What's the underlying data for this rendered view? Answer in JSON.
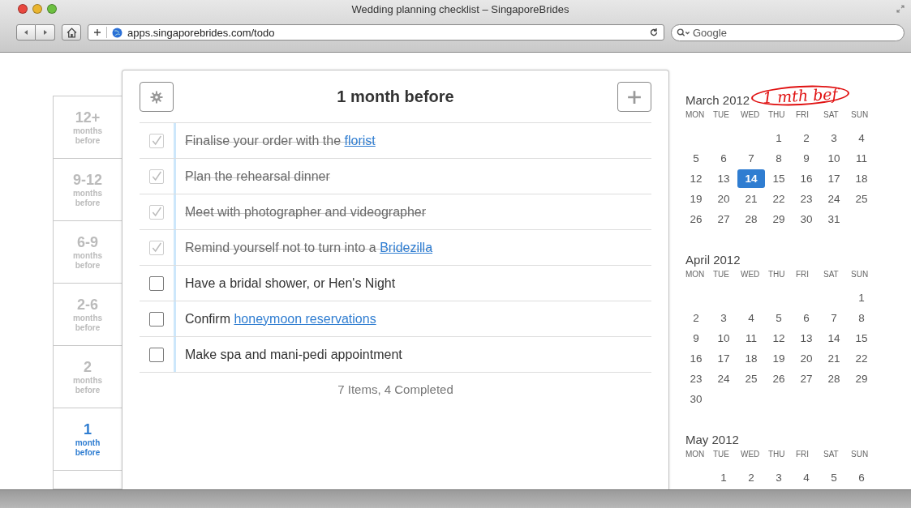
{
  "window": {
    "title": "Wedding planning checklist – SingaporeBrides"
  },
  "toolbar": {
    "url": "apps.singaporebrides.com/todo",
    "search": {
      "placeholder": "Google"
    }
  },
  "sidebar": {
    "items": [
      {
        "number": "12+",
        "lines": [
          "months",
          "before"
        ],
        "selected": false
      },
      {
        "number": "9-12",
        "lines": [
          "months",
          "before"
        ],
        "selected": false
      },
      {
        "number": "6-9",
        "lines": [
          "months",
          "before"
        ],
        "selected": false
      },
      {
        "number": "2-6",
        "lines": [
          "months",
          "before"
        ],
        "selected": false
      },
      {
        "number": "2",
        "lines": [
          "months",
          "before"
        ],
        "selected": false
      },
      {
        "number": "1",
        "lines": [
          "month",
          "before"
        ],
        "selected": true
      }
    ]
  },
  "checklist": {
    "title": "1 month before",
    "footer": "7 Items, 4 Completed",
    "items": [
      {
        "checked": true,
        "parts": [
          {
            "text": "Finalise your order with the "
          },
          {
            "text": "florist",
            "link": true
          }
        ]
      },
      {
        "checked": true,
        "parts": [
          {
            "text": "Plan the rehearsal dinner"
          }
        ]
      },
      {
        "checked": true,
        "parts": [
          {
            "text": "Meet with photographer and videographer"
          }
        ]
      },
      {
        "checked": true,
        "parts": [
          {
            "text": "Remind yourself not to turn into a "
          },
          {
            "text": "Bridezilla",
            "link": true
          }
        ]
      },
      {
        "checked": false,
        "parts": [
          {
            "text": "Have a bridal shower, or Hen's Night"
          }
        ]
      },
      {
        "checked": false,
        "parts": [
          {
            "text": "Confirm "
          },
          {
            "text": "honeymoon reservations",
            "link": true
          }
        ]
      },
      {
        "checked": false,
        "parts": [
          {
            "text": "Make spa and mani-pedi appointment"
          }
        ]
      }
    ]
  },
  "annotation": {
    "text": "1 mth bef",
    "color": "#e01010"
  },
  "calendar": {
    "months": [
      {
        "title": "March 2012",
        "weekdays": [
          "MON",
          "TUE",
          "WED",
          "THU",
          "FRI",
          "SAT",
          "SUN"
        ],
        "weeks": [
          {
            "kind": "lead",
            "days": [
              {
                "d": "1",
                "selected": false
              },
              {
                "d": "2",
                "selected": false
              },
              {
                "d": "3",
                "selected": false
              },
              {
                "d": "4",
                "selected": false
              }
            ]
          },
          {
            "kind": "full",
            "days": [
              {
                "d": "5",
                "selected": false
              },
              {
                "d": "6",
                "selected": false
              },
              {
                "d": "7",
                "selected": false
              },
              {
                "d": "8",
                "selected": false
              },
              {
                "d": "9",
                "selected": false
              },
              {
                "d": "10",
                "selected": false
              },
              {
                "d": "11",
                "selected": false
              }
            ]
          },
          {
            "kind": "full",
            "days": [
              {
                "d": "12",
                "selected": false
              },
              {
                "d": "13",
                "selected": false
              },
              {
                "d": "14",
                "selected": true
              },
              {
                "d": "15",
                "selected": false
              },
              {
                "d": "16",
                "selected": false
              },
              {
                "d": "17",
                "selected": false
              },
              {
                "d": "18",
                "selected": false
              }
            ]
          },
          {
            "kind": "full",
            "days": [
              {
                "d": "19",
                "selected": false
              },
              {
                "d": "20",
                "selected": false
              },
              {
                "d": "21",
                "selected": false
              },
              {
                "d": "22",
                "selected": false
              },
              {
                "d": "23",
                "selected": false
              },
              {
                "d": "24",
                "selected": false
              },
              {
                "d": "25",
                "selected": false
              }
            ]
          },
          {
            "kind": "full",
            "days": [
              {
                "d": "26",
                "selected": false
              },
              {
                "d": "27",
                "selected": false
              },
              {
                "d": "28",
                "selected": false
              },
              {
                "d": "29",
                "selected": false
              },
              {
                "d": "30",
                "selected": false
              },
              {
                "d": "31",
                "selected": false
              }
            ]
          }
        ]
      },
      {
        "title": "April 2012",
        "weekdays": [
          "MON",
          "TUE",
          "WED",
          "THU",
          "FRI",
          "SAT",
          "SUN"
        ],
        "weeks": [
          {
            "kind": "lead",
            "days": [
              {
                "d": "1",
                "selected": false
              }
            ]
          },
          {
            "kind": "full",
            "days": [
              {
                "d": "2",
                "selected": false
              },
              {
                "d": "3",
                "selected": false
              },
              {
                "d": "4",
                "selected": false
              },
              {
                "d": "5",
                "selected": false
              },
              {
                "d": "6",
                "selected": false
              },
              {
                "d": "7",
                "selected": false
              },
              {
                "d": "8",
                "selected": false
              }
            ]
          },
          {
            "kind": "full",
            "days": [
              {
                "d": "9",
                "selected": false
              },
              {
                "d": "10",
                "selected": false
              },
              {
                "d": "11",
                "selected": false
              },
              {
                "d": "12",
                "selected": false
              },
              {
                "d": "13",
                "selected": false
              },
              {
                "d": "14",
                "selected": false
              },
              {
                "d": "15",
                "selected": false
              }
            ]
          },
          {
            "kind": "full",
            "days": [
              {
                "d": "16",
                "selected": false
              },
              {
                "d": "17",
                "selected": false
              },
              {
                "d": "18",
                "selected": false
              },
              {
                "d": "19",
                "selected": false
              },
              {
                "d": "20",
                "selected": false
              },
              {
                "d": "21",
                "selected": false
              },
              {
                "d": "22",
                "selected": false
              }
            ]
          },
          {
            "kind": "full",
            "days": [
              {
                "d": "23",
                "selected": false
              },
              {
                "d": "24",
                "selected": false
              },
              {
                "d": "25",
                "selected": false
              },
              {
                "d": "26",
                "selected": false
              },
              {
                "d": "27",
                "selected": false
              },
              {
                "d": "28",
                "selected": false
              },
              {
                "d": "29",
                "selected": false
              }
            ]
          },
          {
            "kind": "full",
            "days": [
              {
                "d": "30",
                "selected": false
              }
            ]
          }
        ]
      },
      {
        "title": "May 2012",
        "weekdays": [
          "MON",
          "TUE",
          "WED",
          "THU",
          "FRI",
          "SAT",
          "SUN"
        ],
        "weeks": [
          {
            "kind": "lead",
            "days": [
              {
                "d": "1",
                "selected": false
              },
              {
                "d": "2",
                "selected": false
              },
              {
                "d": "3",
                "selected": false
              },
              {
                "d": "4",
                "selected": false
              },
              {
                "d": "5",
                "selected": false
              },
              {
                "d": "6",
                "selected": false
              }
            ]
          }
        ]
      }
    ]
  }
}
